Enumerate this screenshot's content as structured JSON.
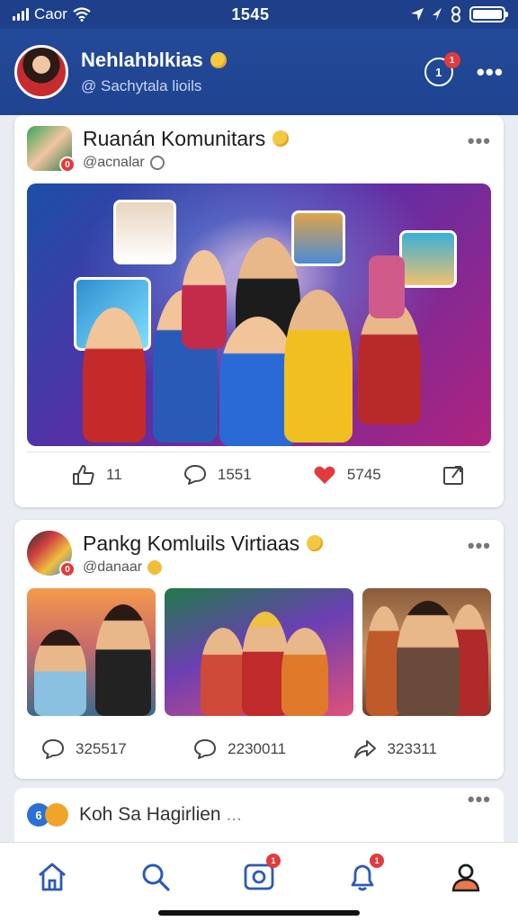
{
  "status_bar": {
    "carrier": "Caor",
    "time": "1545",
    "battery_level": 1.0
  },
  "header": {
    "title": "Nehlahblkias",
    "subtitle": "@ Sachytala lioils",
    "notification_count": "1",
    "notification_icon_text": "1"
  },
  "posts": [
    {
      "title": "Ruanán Komunitars",
      "handle": "@acnalar",
      "avatar_badge": "0",
      "actions": {
        "likes": "11",
        "comments": "1551",
        "hearts": "5745"
      }
    },
    {
      "title": "Pankg Komluils Virtiaas",
      "handle": "@danaar",
      "avatar_badge": "0",
      "stats": {
        "comments": "325517",
        "replies": "2230011",
        "shares": "323311"
      }
    }
  ],
  "partial_post": {
    "badge": "6",
    "title": "Koh Sa Hagirlien",
    "ellipsis": "..."
  },
  "bottom_nav": {
    "camera_badge": "1",
    "notifications_badge": "1"
  },
  "colors": {
    "header_blue": "#1f4390",
    "heart_red": "#e23b3b",
    "badge_red": "#e23b3b"
  }
}
